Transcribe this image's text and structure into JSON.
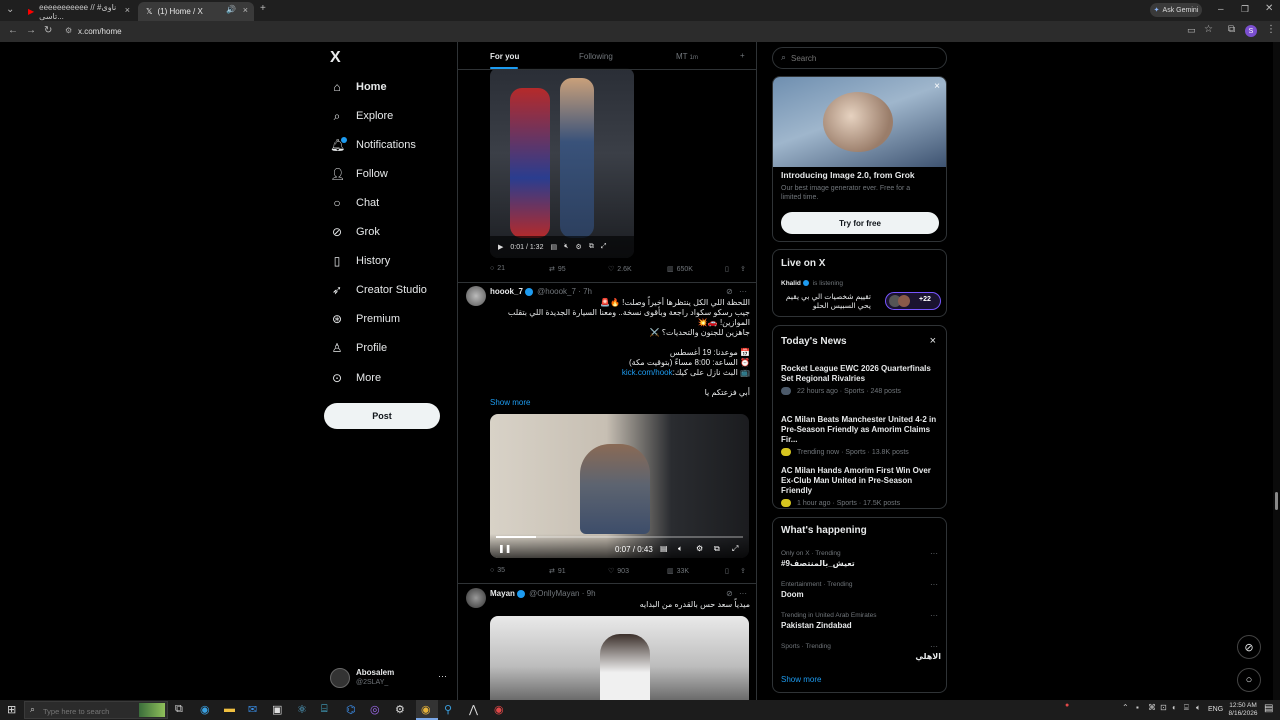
{
  "browser": {
    "tabs": [
      {
        "label": "eeeeeeeeeee // #ناوی تاسی..."
      },
      {
        "label": "(1) Home / X"
      }
    ],
    "new_tab": "+",
    "url": "x.com/home",
    "ask_gemini": "Ask Gemini",
    "profile_initial": "S"
  },
  "nav": {
    "logo": "X",
    "items": [
      {
        "label": "Home",
        "icon": "home-icon"
      },
      {
        "label": "Explore",
        "icon": "search-icon"
      },
      {
        "label": "Notifications",
        "icon": "bell-icon"
      },
      {
        "label": "Follow",
        "icon": "follow-icon"
      },
      {
        "label": "Chat",
        "icon": "chat-icon"
      },
      {
        "label": "Grok",
        "icon": "grok-icon"
      },
      {
        "label": "History",
        "icon": "bookmark-icon"
      },
      {
        "label": "Creator Studio",
        "icon": "rocket-icon"
      },
      {
        "label": "Premium",
        "icon": "premium-icon"
      },
      {
        "label": "Profile",
        "icon": "person-icon"
      },
      {
        "label": "More",
        "icon": "more-icon"
      }
    ],
    "post_label": "Post",
    "account_name": "Abosalem",
    "account_handle": "@2SLAY_",
    "account_more": "···"
  },
  "feed": {
    "tabs": [
      "For you",
      "Following",
      "MT"
    ],
    "tab_extra": "1m",
    "tab_add": "+",
    "post1": {
      "video_time": "0:01 / 1:32",
      "replies": "21",
      "reposts": "95",
      "likes": "2.6K",
      "views": "650K"
    },
    "post2": {
      "name": "hoook_7",
      "handle": "@hoook_7",
      "time": "· 7h",
      "lines": [
        "اللحظة اللي الكل ينتظرها أخيراً وصلت! 🔥🚨",
        "جيب رسكو سكواد راجعة وبأقوى نسخة.. ومعنا السيارة الجديدة اللي بتقلب الموازين! 🚗💥",
        "جاهزين للجنون والتحديات؟ ⚔️",
        "",
        "📅 موعدنا: 19 أغسطس",
        "⏰ الساعة: 8:00 مساءً (بتوقيت مكة)",
        "📺 البث نازل على كيك:",
        "",
        "أبي فزعتكم يا"
      ],
      "link": "kick.com/hook",
      "show_more": "Show more",
      "video_time": "0:07 / 0:43",
      "replies": "35",
      "reposts": "91",
      "likes": "903",
      "views": "33K"
    },
    "post3": {
      "name": "Mayan",
      "handle": "@OnllyMayan",
      "time": "· 9h",
      "text": "ميدياً سعد حس بالقدره من البدايه"
    }
  },
  "right": {
    "search_placeholder": "Search",
    "promo": {
      "title": "Introducing Image 2.0, from Grok",
      "desc": "Our best image generator ever. Free for a limited time.",
      "cta": "Try for free",
      "close": "×"
    },
    "live": {
      "title": "Live on X",
      "host": "Khalid",
      "status": "is listening",
      "text": "تقييم شخصيات الي بي يقيم يحي السبيس الحلو",
      "count": "+22"
    },
    "news": {
      "title": "Today's News",
      "close": "×",
      "items": [
        {
          "headline": "Rocket League EWC 2026 Quarterfinals Set Regional Rivalries",
          "meta": "22 hours ago · Sports · 248 posts"
        },
        {
          "headline": "AC Milan Beats Manchester United 4-2 in Pre-Season Friendly as Amorim Claims Fir...",
          "meta": "Trending now · Sports · 13.8K posts"
        },
        {
          "headline": "AC Milan Hands Amorim First Win Over Ex-Club Man United in Pre-Season Friendly",
          "meta": "1 hour ago · Sports · 17.5K posts"
        }
      ]
    },
    "happening": {
      "title": "What's happening",
      "items": [
        {
          "context": "Only on X · Trending",
          "name": "#تعيش_بالمنتصف9"
        },
        {
          "context": "Entertainment · Trending",
          "name": "Doom"
        },
        {
          "context": "Trending in United Arab Emirates",
          "name": "Pakistan Zindabad"
        },
        {
          "context": "Sports · Trending",
          "name": "الاهلي"
        }
      ],
      "show_more": "Show more"
    }
  },
  "taskbar": {
    "search_placeholder": "Type here to search",
    "time": "12:50 AM",
    "date": "8/16/2026",
    "lang": "ENG"
  }
}
